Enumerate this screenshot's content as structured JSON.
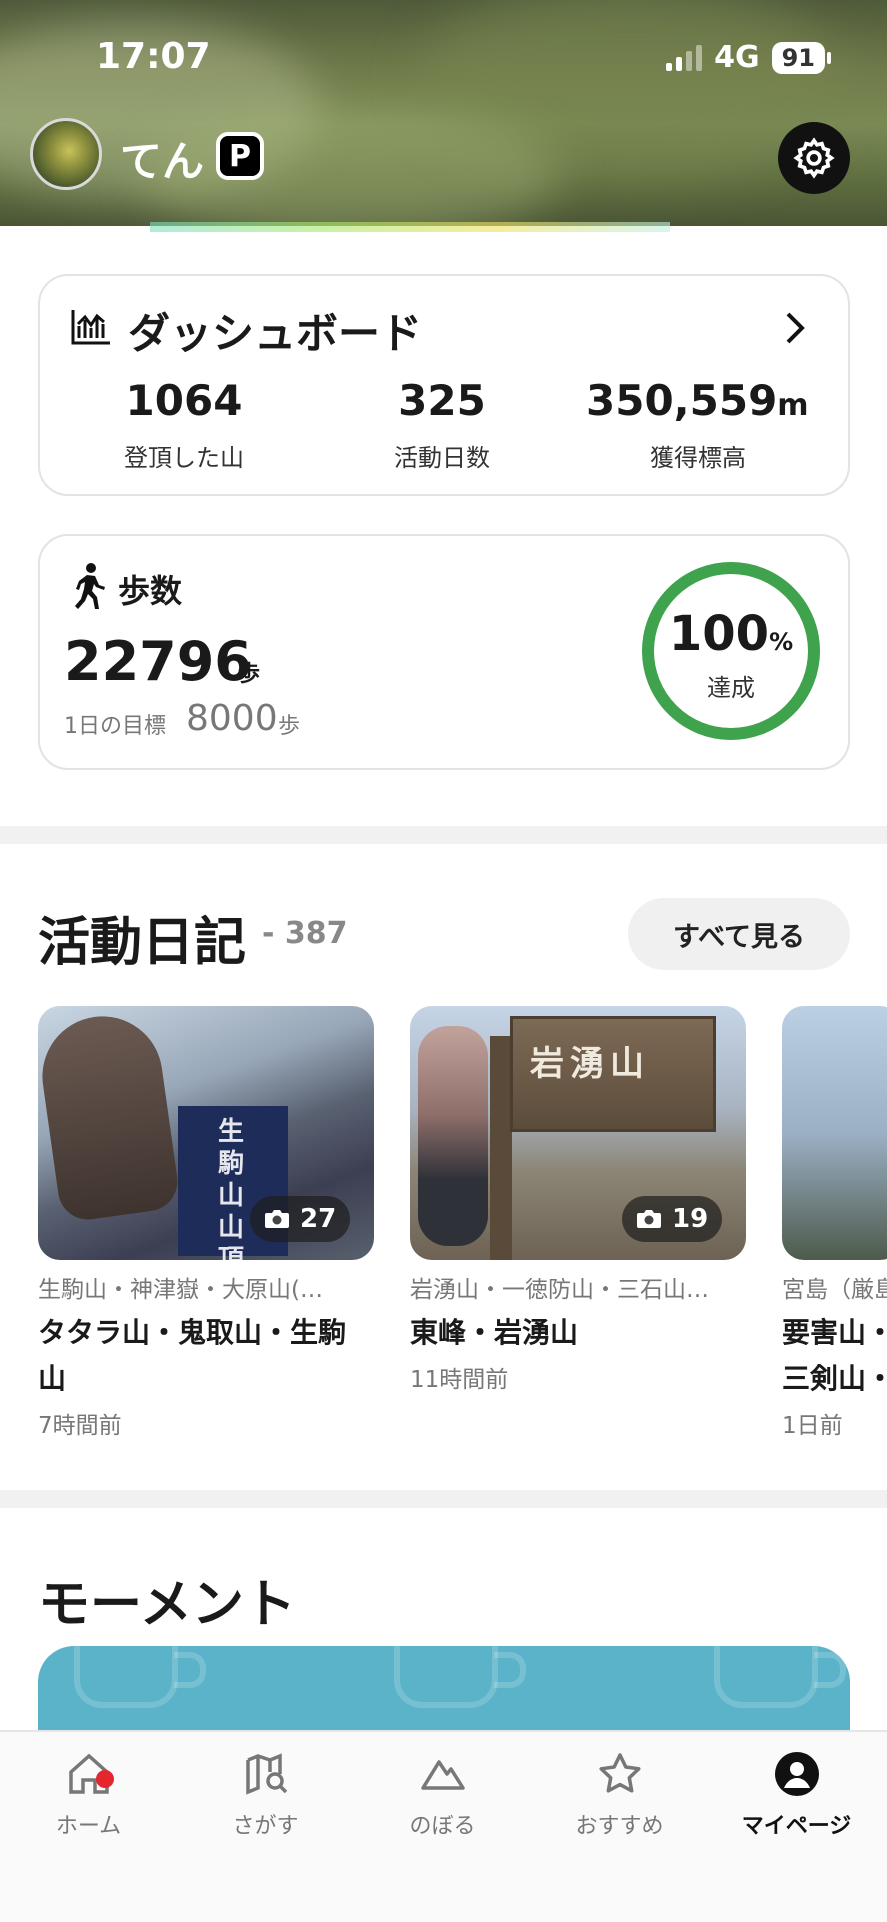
{
  "status_bar": {
    "time": "17:07",
    "network": "4G",
    "battery": "91"
  },
  "profile": {
    "username": "てん",
    "badge": "P"
  },
  "dashboard": {
    "title": "ダッシュボード",
    "stats": [
      {
        "value": "1064",
        "unit": "",
        "label": "登頂した山"
      },
      {
        "value": "325",
        "unit": "",
        "label": "活動日数"
      },
      {
        "value": "350,559",
        "unit": "m",
        "label": "獲得標高"
      }
    ]
  },
  "steps": {
    "title": "歩数",
    "value": "22796",
    "unit": "歩",
    "goal_label": "1日の目標",
    "goal_value": "8000",
    "goal_unit": "歩",
    "achievement_percent": "100",
    "achievement_symbol": "%",
    "achievement_label": "達成",
    "ring_color": "#3fa34d"
  },
  "diary": {
    "title": "活動日記",
    "count": "- 387",
    "see_all": "すべて見る",
    "items": [
      {
        "photos": "27",
        "subtitle": "生駒山・神津嶽・大原山(…",
        "title_line1": "タタラ山・鬼取山・生駒",
        "title_line2": "山",
        "time": "7時間前",
        "sign_text": "生駒山 山頂"
      },
      {
        "photos": "19",
        "subtitle": "岩湧山・一徳防山・三石山…",
        "title_line1": "東峰・岩湧山",
        "title_line2": "",
        "time": "11時間前",
        "sign_text": "岩湧山"
      },
      {
        "photos": "",
        "subtitle": "宮島（厳島",
        "title_line1": "要害山・",
        "title_line2": "三剣山・",
        "time": "1日前"
      }
    ]
  },
  "moment": {
    "title": "モーメント",
    "card_color": "#5ab3c8"
  },
  "bottom_nav": [
    {
      "label": "ホーム",
      "icon": "home-icon",
      "active": false,
      "notification": true
    },
    {
      "label": "さがす",
      "icon": "map-search-icon",
      "active": false
    },
    {
      "label": "のぼる",
      "icon": "mountain-icon",
      "active": false
    },
    {
      "label": "おすすめ",
      "icon": "star-icon",
      "active": false
    },
    {
      "label": "マイページ",
      "icon": "user-icon",
      "active": true
    }
  ]
}
